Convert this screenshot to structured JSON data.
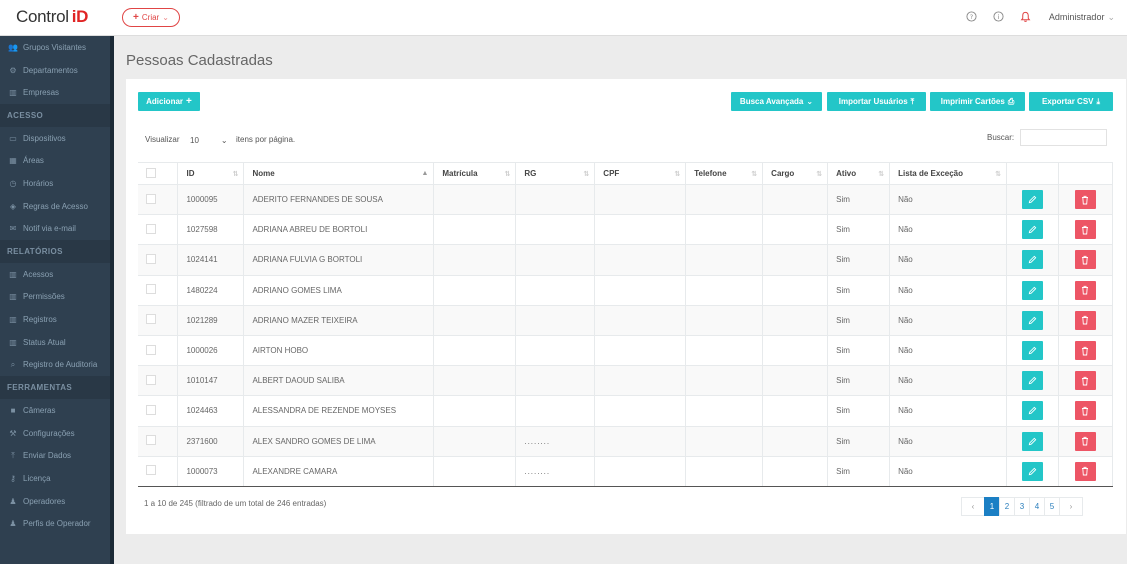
{
  "topbar": {
    "logo_text": "Control",
    "logo_accent": "iD",
    "create_label": "Criar",
    "user": "Administrador"
  },
  "sidebar": {
    "items": [
      {
        "label": "Grupos Visitantes",
        "icon": "users-icon",
        "type": "item"
      },
      {
        "label": "Departamentos",
        "icon": "sitemap-icon",
        "type": "item"
      },
      {
        "label": "Empresas",
        "icon": "chart-icon",
        "type": "item"
      },
      {
        "label": "ACESSO",
        "type": "section"
      },
      {
        "label": "Dispositivos",
        "icon": "laptop-icon",
        "type": "item"
      },
      {
        "label": "Áreas",
        "icon": "building-icon",
        "type": "item"
      },
      {
        "label": "Horários",
        "icon": "clock-icon",
        "type": "item"
      },
      {
        "label": "Regras de Acesso",
        "icon": "shield-icon",
        "type": "item"
      },
      {
        "label": "Notif via e-mail",
        "icon": "envelope-icon",
        "type": "item"
      },
      {
        "label": "RELATÓRIOS",
        "type": "section"
      },
      {
        "label": "Acessos",
        "icon": "bar-chart-icon",
        "type": "item"
      },
      {
        "label": "Permissões",
        "icon": "bar-chart-icon",
        "type": "item"
      },
      {
        "label": "Registros",
        "icon": "bar-chart-icon",
        "type": "item"
      },
      {
        "label": "Status Atual",
        "icon": "bar-chart-icon",
        "type": "item"
      },
      {
        "label": "Registro de Auditoria",
        "icon": "search-icon",
        "type": "item"
      },
      {
        "label": "FERRAMENTAS",
        "type": "section"
      },
      {
        "label": "Câmeras",
        "icon": "camera-icon",
        "type": "item"
      },
      {
        "label": "Configurações",
        "icon": "wrench-icon",
        "type": "item"
      },
      {
        "label": "Enviar Dados",
        "icon": "upload-icon",
        "type": "item"
      },
      {
        "label": "Licença",
        "icon": "key-icon",
        "type": "item"
      },
      {
        "label": "Operadores",
        "icon": "user-icon",
        "type": "item"
      },
      {
        "label": "Perfis de Operador",
        "icon": "user-icon",
        "type": "item"
      }
    ]
  },
  "page": {
    "title": "Pessoas Cadastradas"
  },
  "toolbar": {
    "add_label": "Adicionar",
    "advanced_search_label": "Busca Avançada",
    "import_label": "Importar Usuários",
    "print_cards_label": "Imprimir Cartões",
    "export_label": "Exportar CSV"
  },
  "table_controls": {
    "show_label": "Visualizar",
    "page_length": "10",
    "per_page_label": "itens por página.",
    "search_label": "Buscar:",
    "search_value": ""
  },
  "table": {
    "columns": [
      "",
      "ID",
      "Nome",
      "Matrícula",
      "RG",
      "CPF",
      "Telefone",
      "Cargo",
      "Ativo",
      "Lista de Exceção",
      "",
      ""
    ],
    "rows": [
      {
        "id": "1000095",
        "name": "ADERITO FERNANDES DE SOUSA",
        "matricula": "",
        "rg": "",
        "cpf": "",
        "phone": "",
        "cargo": "",
        "active": "Sim",
        "exception": "Não"
      },
      {
        "id": "1027598",
        "name": "ADRIANA ABREU DE BORTOLI",
        "matricula": "",
        "rg": "",
        "cpf": "",
        "phone": "",
        "cargo": "",
        "active": "Sim",
        "exception": "Não"
      },
      {
        "id": "1024141",
        "name": "ADRIANA FULVIA G BORTOLI",
        "matricula": "",
        "rg": "",
        "cpf": "",
        "phone": "",
        "cargo": "",
        "active": "Sim",
        "exception": "Não"
      },
      {
        "id": "1480224",
        "name": "ADRIANO GOMES LIMA",
        "matricula": "",
        "rg": "",
        "cpf": "",
        "phone": "",
        "cargo": "",
        "active": "Sim",
        "exception": "Não"
      },
      {
        "id": "1021289",
        "name": "ADRIANO MAZER TEIXEIRA",
        "matricula": "",
        "rg": "",
        "cpf": "",
        "phone": "",
        "cargo": "",
        "active": "Sim",
        "exception": "Não"
      },
      {
        "id": "1000026",
        "name": "AIRTON HOBO",
        "matricula": "",
        "rg": "",
        "cpf": "",
        "phone": "",
        "cargo": "",
        "active": "Sim",
        "exception": "Não"
      },
      {
        "id": "1010147",
        "name": "ALBERT DAOUD SALIBA",
        "matricula": "",
        "rg": "",
        "cpf": "",
        "phone": "",
        "cargo": "",
        "active": "Sim",
        "exception": "Não"
      },
      {
        "id": "1024463",
        "name": "ALESSANDRA DE REZENDE MOYSES",
        "matricula": "",
        "rg": "",
        "cpf": "",
        "phone": "",
        "cargo": "",
        "active": "Sim",
        "exception": "Não"
      },
      {
        "id": "2371600",
        "name": "ALEX SANDRO GOMES DE LIMA",
        "matricula": "",
        "rg": "........",
        "cpf": "",
        "phone": "",
        "cargo": "",
        "active": "Sim",
        "exception": "Não"
      },
      {
        "id": "1000073",
        "name": "ALEXANDRE CAMARA",
        "matricula": "",
        "rg": "........",
        "cpf": "",
        "phone": "",
        "cargo": "",
        "active": "Sim",
        "exception": "Não"
      }
    ]
  },
  "footer": {
    "info": "1 a 10 de 245 (filtrado de um total de 246 entradas)",
    "pages": [
      "1",
      "2",
      "3",
      "4",
      "5"
    ],
    "prev_label": "‹",
    "next_label": "›",
    "active_page": "1"
  },
  "colors": {
    "accent": "#23c6c8",
    "danger": "#ed5565",
    "sidebar_bg": "#2f4050",
    "brand_red": "#e02424",
    "pagination_active": "#1b7fc4"
  }
}
